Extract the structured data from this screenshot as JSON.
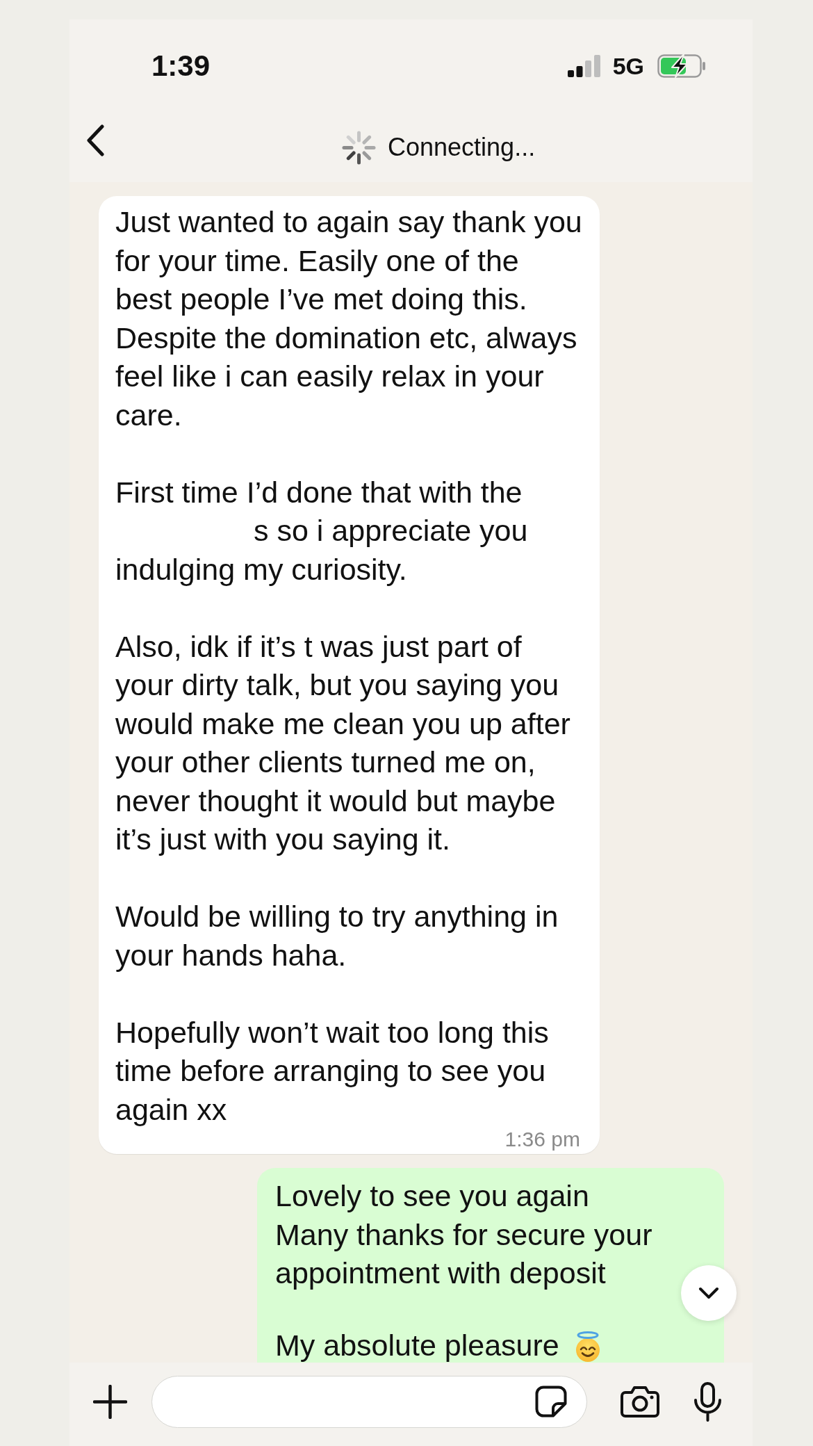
{
  "status_bar": {
    "time": "1:39",
    "network": "5G"
  },
  "header": {
    "status": "Connecting..."
  },
  "incoming_message": {
    "paragraphs": [
      [
        {
          "text": "Just wanted to again say thank you\nfor your time. Easily one of the\nbest people I’ve met doing this.\nDespite the domination etc, always\nfeel like i can easily relax in your\ncare.",
          "redacted_prefix": false
        }
      ],
      [
        {
          "text": "First time I’d done that with the",
          "redacted_prefix": false
        },
        {
          "text": "s so i appreciate you\nindulging my curiosity.",
          "redacted_prefix": true
        }
      ],
      [
        {
          "text": "Also, idk if it’s t was just part of\nyour dirty talk, but you saying you\nwould make me clean you up after\nyour other clients turned me on,\nnever thought it would but maybe\nit’s just with you saying it.",
          "redacted_prefix": false
        }
      ],
      [
        {
          "text": "Would be willing to try anything in\nyour hands haha.",
          "redacted_prefix": false
        }
      ],
      [
        {
          "text": "Hopefully won’t wait too long this\ntime before arranging to see you\nagain xx",
          "redacted_prefix": false
        }
      ]
    ],
    "time": "1:36 pm"
  },
  "outgoing_message": {
    "paragraphs": [
      {
        "text": "Lovely to see you again\nMany thanks for secure your\nappointment with deposit",
        "trailing_emoji": false
      },
      {
        "text": "My absolute pleasure",
        "trailing_emoji": true
      }
    ]
  }
}
